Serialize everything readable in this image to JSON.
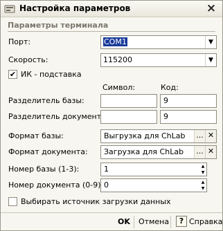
{
  "window": {
    "title": "Настройка параметров",
    "close_icon": "×"
  },
  "section": {
    "title": "Параметры терминала"
  },
  "port": {
    "label": "Порт:",
    "value": "COM1"
  },
  "speed": {
    "label": "Скорость:",
    "value": "115200"
  },
  "ik": {
    "label": "ИК - подставка",
    "checked": true,
    "mark": "✔"
  },
  "columns": {
    "symbol": "Символ:",
    "code": "Код:"
  },
  "base_sep": {
    "label": "Разделитель базы:",
    "symbol": "",
    "code": "9"
  },
  "doc_sep": {
    "label": "Разделитель документа:",
    "symbol": "",
    "code": "9"
  },
  "base_format": {
    "label": "Формат базы:",
    "value": "Выгрузка для ChLab",
    "select_btn": "...",
    "clear_btn": "✕"
  },
  "doc_format": {
    "label": "Формат документа:",
    "value": "Загрузка для ChLab",
    "select_btn": "...",
    "clear_btn": "✕"
  },
  "base_number": {
    "label": "Номер базы (1-3):",
    "value": "1"
  },
  "doc_number": {
    "label": "Номер документа (0-9):",
    "value": "0"
  },
  "choose_source": {
    "label": "Выбирать источник загрузки данных",
    "checked": false
  },
  "footer": {
    "ok": "OK",
    "cancel": "Отмена",
    "help": "Справка",
    "help_icon": "?"
  },
  "colors": {
    "accent_highlight": "#1a3b9b",
    "section_text": "#7a766c"
  }
}
